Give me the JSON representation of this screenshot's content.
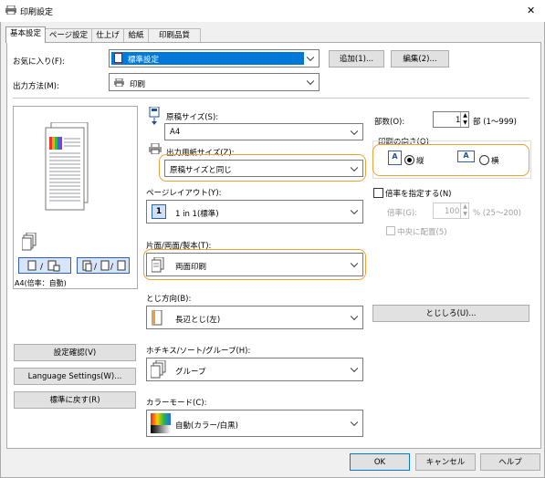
{
  "window": {
    "title": "印刷設定",
    "close_glyph": "✕"
  },
  "tabs": [
    "基本設定",
    "ページ設定",
    "仕上げ",
    "給紙",
    "印刷品質"
  ],
  "favorites": {
    "label": "お気に入り(F):",
    "value": "標準設定",
    "add": "追加(1)...",
    "edit": "編集(2)..."
  },
  "output_method": {
    "label": "出力方法(M):",
    "value": "印刷"
  },
  "preview": {
    "caption": "A4(倍率：自動)"
  },
  "left_buttons": {
    "confirm": "設定確認(V)",
    "language": "Language Settings(W)...",
    "defaults": "標準に戻す(R)"
  },
  "original_size": {
    "label": "原稿サイズ(S):",
    "value": "A4"
  },
  "output_paper_size": {
    "label": "出力用紙サイズ(Z):",
    "value": "原稿サイズと同じ"
  },
  "page_layout": {
    "label": "ページレイアウト(Y):",
    "value": "1 in 1(標準)",
    "icon_text": "1"
  },
  "duplex": {
    "label": "片面/両面/製本(T):",
    "value": "両面印刷"
  },
  "binding_direction": {
    "label": "とじ方向(B):",
    "value": "長辺とじ(左)"
  },
  "stapler": {
    "label": "ホチキス/ソート/グループ(H):",
    "value": "グループ"
  },
  "color_mode": {
    "label": "カラーモード(C):",
    "value": "自動(カラー/白黒)"
  },
  "copies": {
    "label": "部数(O):",
    "value": "1",
    "range": "部 (1〜999)"
  },
  "orientation": {
    "label": "印刷の向き(O)",
    "portrait": "縦",
    "landscape": "横",
    "selected": "portrait"
  },
  "scaling": {
    "checkbox": "倍率を指定する(N)",
    "ratio_label": "倍率(G):",
    "ratio_value": "100",
    "range": "% (25〜200)",
    "center": "中央に配置(5)"
  },
  "binding_margin_button": "とじしろ(U)...",
  "footer": {
    "ok": "OK",
    "cancel": "キャンセル",
    "help": "ヘルプ"
  },
  "colors": {
    "accent_orange": "#f0a030",
    "selected_blue": "#0078d7"
  }
}
